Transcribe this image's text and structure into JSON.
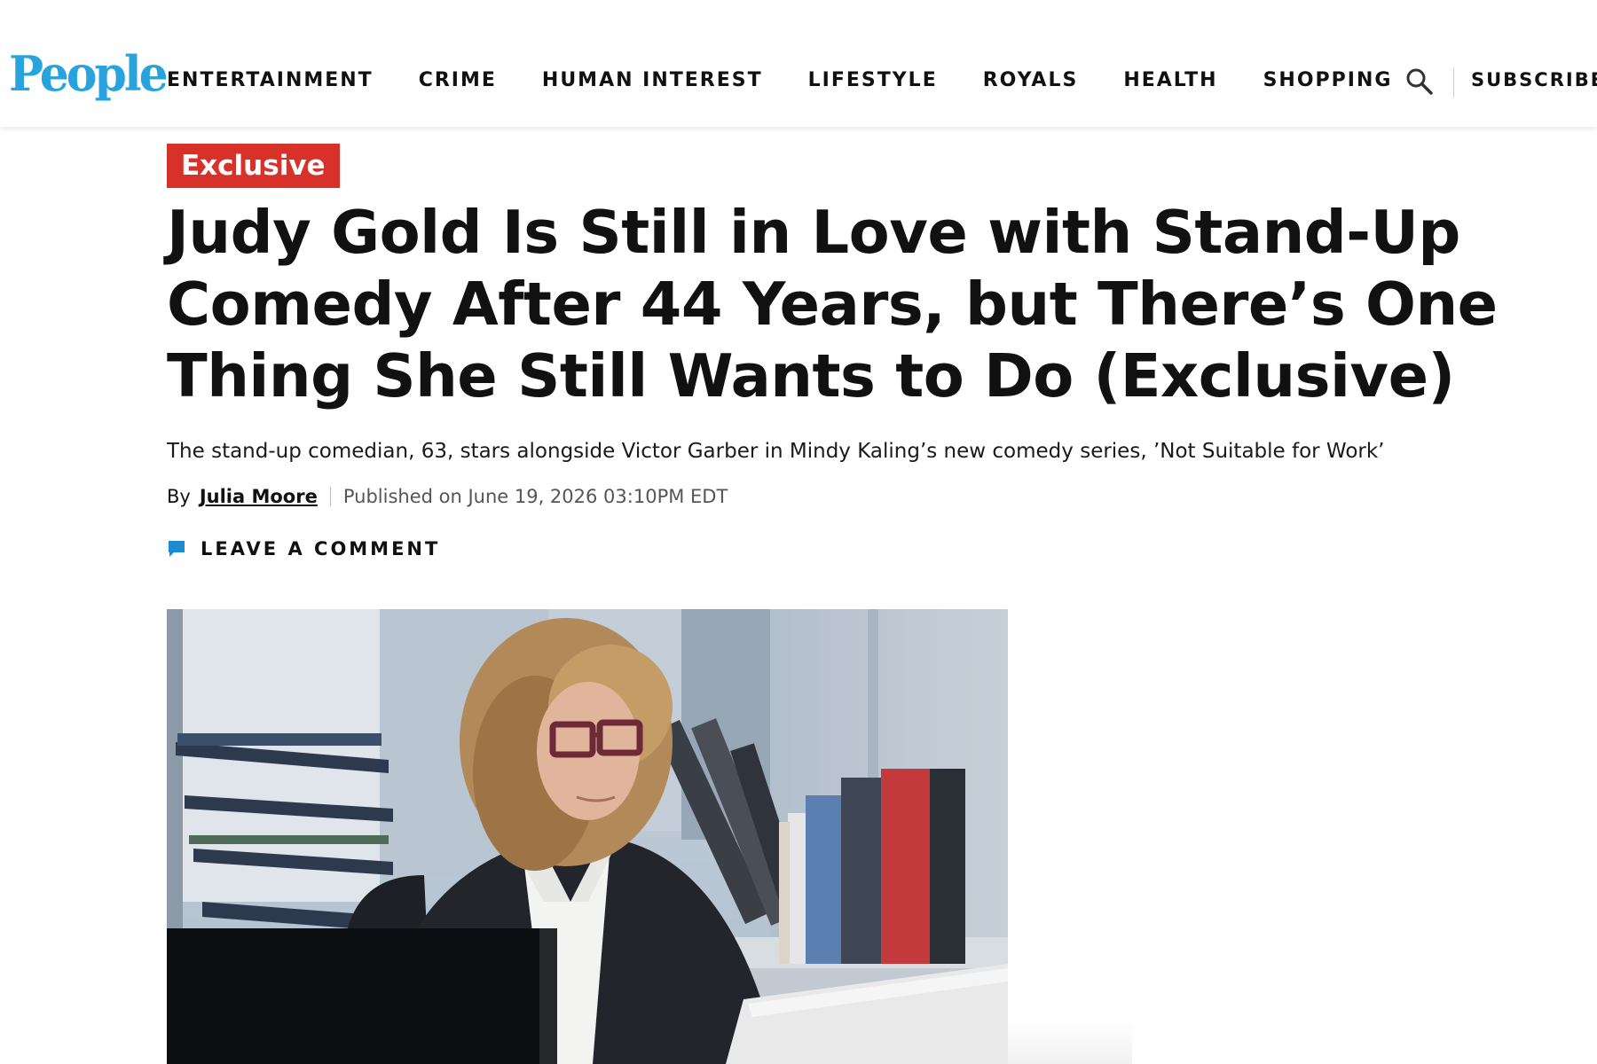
{
  "brand": {
    "logo_text": "People",
    "logo_color": "#29a3dd"
  },
  "nav": {
    "items": [
      {
        "label": "ENTERTAINMENT"
      },
      {
        "label": "CRIME"
      },
      {
        "label": "HUMAN INTEREST"
      },
      {
        "label": "LIFESTYLE"
      },
      {
        "label": "ROYALS"
      },
      {
        "label": "HEALTH"
      },
      {
        "label": "SHOPPING"
      }
    ],
    "search_icon": "search-icon",
    "subscribe_label": "SUBSCRIBE"
  },
  "article": {
    "badge": "Exclusive",
    "badge_color": "#d8312a",
    "headline": "Judy Gold Is Still in Love with Stand-Up Comedy After 44 Years, but There’s One Thing She Still Wants to Do (Exclusive)",
    "dek": "The stand-up comedian, 63, stars alongside Victor Garber in Mindy Kaling’s new comedy series, ’Not Suitable for Work’",
    "byline_prefix": "By",
    "author": "Julia Moore",
    "published": "Published on June 19, 2026 03:10PM EDT",
    "comment_label": "LEAVE A COMMENT",
    "comment_icon": "comment-icon",
    "comment_icon_color": "#1a8ccf"
  }
}
